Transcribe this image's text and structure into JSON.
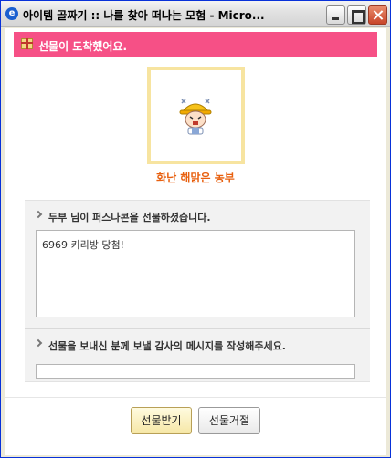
{
  "window": {
    "title": "아이템 골짜기 :: 나를 찾아 떠나는 모험 - Micro...",
    "icon": "ie-icon"
  },
  "banner": {
    "text": "선물이 도착했어요.",
    "color": "#f65086",
    "icon": "gift-icon"
  },
  "item": {
    "name": "화난 해맑은 농부",
    "name_color": "#e8600f"
  },
  "message_section": {
    "title": "두부 님이 퍼스나콘을 선물하셨습니다.",
    "message": "6969 키리방 당첨!"
  },
  "reply_section": {
    "title": "선물을 보내신 분께 보낼 감사의 메시지를 작성해주세요.",
    "value": ""
  },
  "buttons": {
    "accept": "선물받기",
    "reject": "선물거절"
  }
}
